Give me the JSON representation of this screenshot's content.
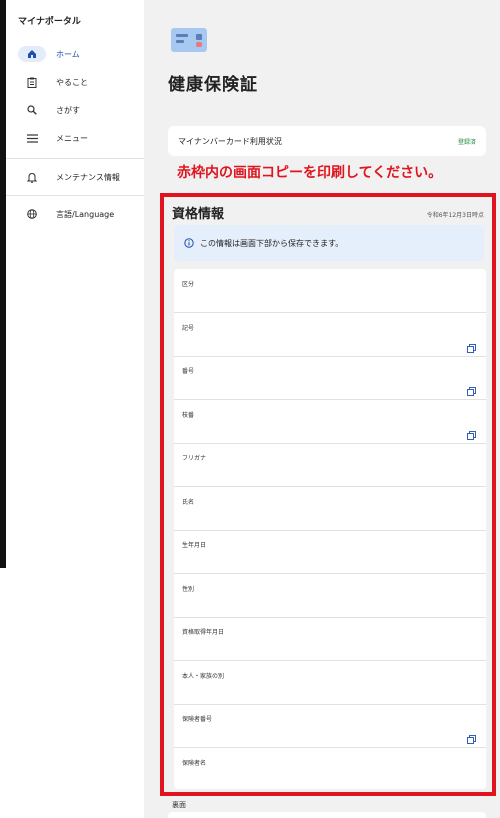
{
  "sidebar": {
    "title": "マイナポータル",
    "items": [
      {
        "label": "ホーム",
        "icon": "home-icon",
        "active": true
      },
      {
        "label": "やること",
        "icon": "clipboard-icon"
      },
      {
        "label": "さがす",
        "icon": "search-icon"
      },
      {
        "label": "メニュー",
        "icon": "menu-icon"
      },
      {
        "label": "メンテナンス情報",
        "icon": "bell-icon"
      },
      {
        "label": "言語/Language",
        "icon": "globe-icon"
      }
    ]
  },
  "main": {
    "title": "健康保険証",
    "status_card": {
      "label": "マイナンバーカード利用状況",
      "value": "登録済"
    },
    "notice": "赤枠内の画面コピーを印刷してください。",
    "section": {
      "title": "資格情報",
      "date": "令和6年12月3日時点",
      "info": "この情報は画面下部から保存できます。",
      "fields": [
        {
          "label": "区分",
          "copy": false
        },
        {
          "label": "記号",
          "copy": true
        },
        {
          "label": "番号",
          "copy": true
        },
        {
          "label": "枝番",
          "copy": true
        },
        {
          "label": "フリガナ",
          "copy": false
        },
        {
          "label": "氏名",
          "copy": false
        },
        {
          "label": "生年月日",
          "copy": false
        },
        {
          "label": "性別",
          "copy": false
        },
        {
          "label": "資格取得年月日",
          "copy": false
        },
        {
          "label": "本人・家族の別",
          "copy": false
        },
        {
          "label": "保険者番号",
          "copy": true
        },
        {
          "label": "保険者名",
          "copy": false
        }
      ]
    },
    "back_label": "裏面"
  },
  "colors": {
    "accent": "#1f4db3",
    "notice": "#e0141e",
    "status": "#1d8a3a",
    "info_bg": "#e5eefb"
  }
}
